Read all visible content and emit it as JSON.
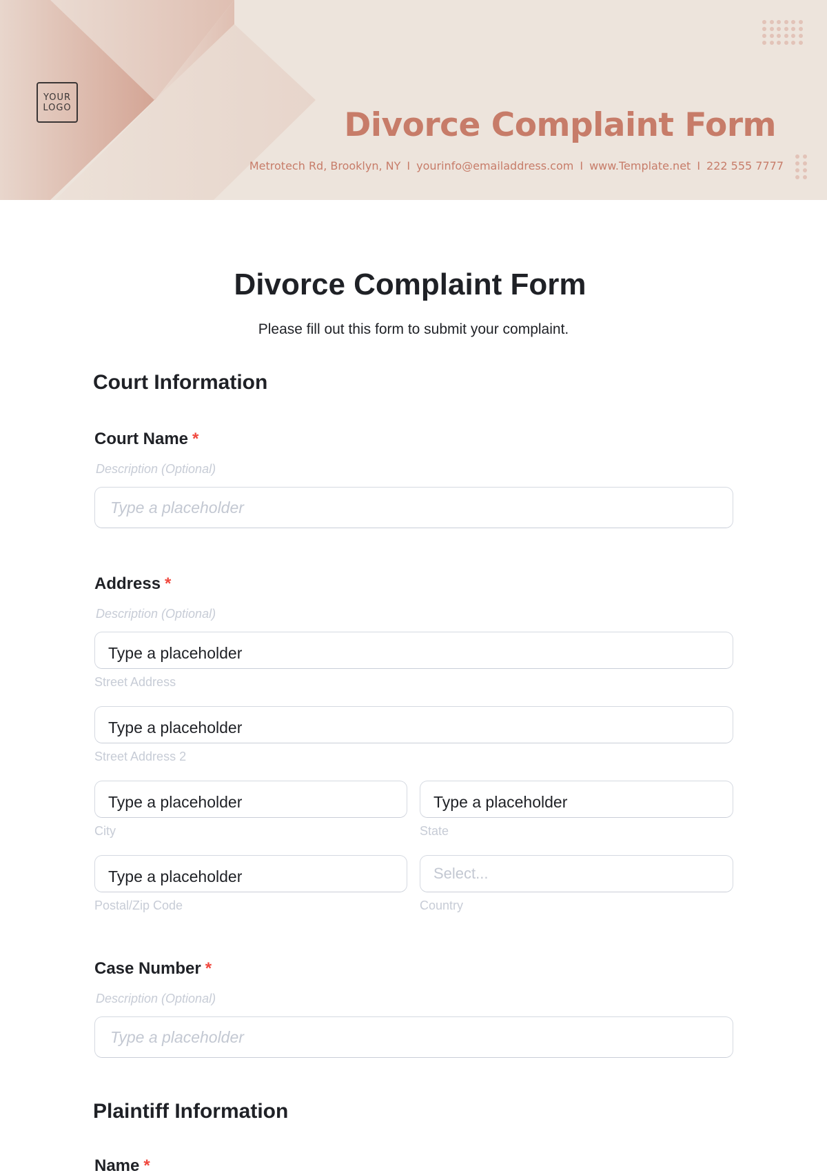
{
  "header": {
    "logo_line1": "YOUR",
    "logo_line2": "LOGO",
    "title": "Divorce Complaint Form",
    "contact": {
      "address": "Metrotech Rd, Brooklyn, NY",
      "email": "yourinfo@emailaddress.com",
      "website": "www.Template.net",
      "phone": "222 555 7777",
      "separator": "I"
    },
    "colors": {
      "accent": "#c77c69",
      "background": "#ede4dc"
    }
  },
  "form": {
    "title": "Divorce Complaint Form",
    "subtitle": "Please fill out this form to submit your complaint.",
    "sections": [
      {
        "title": "Court Information",
        "fields": [
          {
            "label": "Court Name",
            "required_mark": "*",
            "description": "Description (Optional)",
            "placeholder": "Type a placeholder"
          },
          {
            "label": "Address",
            "required_mark": "*",
            "description": "Description (Optional)",
            "subfields": [
              {
                "value": "Type a placeholder",
                "sublabel": "Street Address"
              },
              {
                "value": "Type a placeholder",
                "sublabel": "Street Address 2"
              },
              {
                "value": "Type a placeholder",
                "sublabel": "City"
              },
              {
                "value": "Type a placeholder",
                "sublabel": "State"
              },
              {
                "value": "Type a placeholder",
                "sublabel": "Postal/Zip Code"
              },
              {
                "value": "Select...",
                "sublabel": "Country"
              }
            ]
          },
          {
            "label": "Case Number",
            "required_mark": "*",
            "description": "Description (Optional)",
            "placeholder": "Type a placeholder"
          }
        ]
      },
      {
        "title": "Plaintiff Information",
        "fields": [
          {
            "label": "Name",
            "required_mark": "*"
          }
        ]
      }
    ],
    "colors": {
      "required": "#f0483e",
      "text": "#1f2126",
      "muted": "#c7ccd6",
      "border": "#d5d9e1"
    }
  }
}
